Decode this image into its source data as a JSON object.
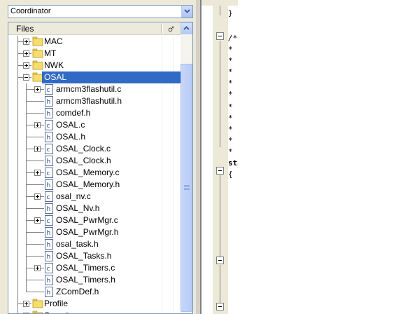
{
  "config_select": {
    "value": "Coordinator"
  },
  "workspace": {
    "header_label": "Files",
    "tree": [
      {
        "label": "MAC",
        "type": "folder",
        "expanded": false
      },
      {
        "label": "MT",
        "type": "folder",
        "expanded": false
      },
      {
        "label": "NWK",
        "type": "folder",
        "expanded": false
      },
      {
        "label": "OSAL",
        "type": "folder",
        "expanded": true,
        "selected": true
      },
      {
        "label": "armcm3flashutil.c",
        "type": "c",
        "expandable": true
      },
      {
        "label": "armcm3flashutil.h",
        "type": "h"
      },
      {
        "label": "comdef.h",
        "type": "h"
      },
      {
        "label": "OSAL.c",
        "type": "c",
        "expandable": true
      },
      {
        "label": "OSAL.h",
        "type": "h"
      },
      {
        "label": "OSAL_Clock.c",
        "type": "c",
        "expandable": true
      },
      {
        "label": "OSAL_Clock.h",
        "type": "h"
      },
      {
        "label": "OSAL_Memory.c",
        "type": "c",
        "expandable": true
      },
      {
        "label": "OSAL_Memory.h",
        "type": "h"
      },
      {
        "label": "osal_nv.c",
        "type": "c",
        "expandable": true
      },
      {
        "label": "OSAL_Nv.h",
        "type": "h"
      },
      {
        "label": "OSAL_PwrMgr.c",
        "type": "c",
        "expandable": true
      },
      {
        "label": "OSAL_PwrMgr.h",
        "type": "h"
      },
      {
        "label": "osal_task.h",
        "type": "h"
      },
      {
        "label": "OSAL_Tasks.h",
        "type": "h"
      },
      {
        "label": "OSAL_Timers.c",
        "type": "c",
        "expandable": true
      },
      {
        "label": "OSAL_Timers.h",
        "type": "h"
      },
      {
        "label": "ZComDef.h",
        "type": "h"
      },
      {
        "label": "Profile",
        "type": "folder",
        "expanded": false
      },
      {
        "label": "Security",
        "type": "folder",
        "expanded": false
      }
    ]
  },
  "editor": {
    "visible_text": [
      "}",
      "/*",
      "*",
      "*",
      "*",
      "*",
      "*",
      "*",
      "*",
      "*",
      "*",
      "*",
      "sta",
      "{"
    ]
  },
  "colors": {
    "selection": "#316ac5",
    "panel": "#ece9d8",
    "border": "#7f9db9"
  },
  "icons": {
    "folder": "folder-icon",
    "c_file": "c-file-icon",
    "h_file": "h-file-icon"
  }
}
